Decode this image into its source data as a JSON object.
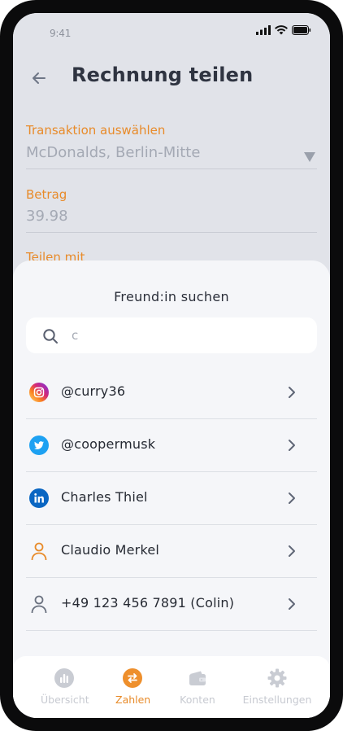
{
  "status_bar": {
    "time": "9:41"
  },
  "header": {
    "title": "Rechnung teilen"
  },
  "form": {
    "transaction_label": "Transaktion auswählen",
    "transaction_value": "McDonalds, Berlin-Mitte",
    "amount_label": "Betrag",
    "amount_value": "39.98",
    "share_label": "Teilen mit"
  },
  "sheet": {
    "title": "Freund:in suchen",
    "search": {
      "value": "c",
      "placeholder": ""
    },
    "results": [
      {
        "label": "@curry36",
        "icon": "instagram-icon"
      },
      {
        "label": "@coopermusk",
        "icon": "twitter-icon"
      },
      {
        "label": "Charles Thiel",
        "icon": "linkedin-icon"
      },
      {
        "label": "Claudio Merkel",
        "icon": "person-icon"
      },
      {
        "label": "+49 123 456 7891 (Colin)",
        "icon": "person-icon"
      }
    ]
  },
  "tabbar": {
    "items": [
      {
        "label": "Übersicht",
        "icon": "chart-icon"
      },
      {
        "label": "Zahlen",
        "icon": "transfer-icon"
      },
      {
        "label": "Konten",
        "icon": "wallet-icon"
      },
      {
        "label": "Einstellungen",
        "icon": "gear-icon"
      }
    ],
    "active": "Zahlen"
  },
  "colors": {
    "accent": "#e88b2a",
    "title": "#2f3441",
    "instagram": "#d62976",
    "twitter": "#1da1f2",
    "linkedin": "#0a66c2"
  }
}
